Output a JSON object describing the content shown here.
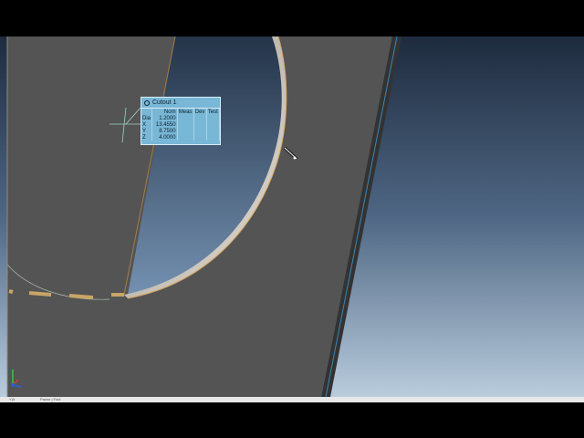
{
  "cutout_box": {
    "title": "Cutout 1",
    "headers": [
      "Nom",
      "Meas",
      "Dev",
      "Test"
    ],
    "rows": [
      {
        "label": "Dia",
        "nom": "1.2000"
      },
      {
        "label": "X",
        "nom": "13.4550"
      },
      {
        "label": "Y",
        "nom": "8.7500"
      },
      {
        "label": "Z",
        "nom": "4.0000"
      }
    ]
  },
  "status_bar": {
    "left": "Y|X",
    "mid": "Pause | Fold"
  },
  "colors": {
    "part_surface": "#545454",
    "sky_top": "#1e2b3e",
    "sky_bottom": "#b9ccdd",
    "hole_edge": "#d2a15a",
    "panel_blue": "#79b7d6"
  },
  "icons": {
    "axis": "xyz-axis-icon",
    "cursor": "pointer-cursor-icon",
    "crosshair": "crosshair-icon"
  }
}
